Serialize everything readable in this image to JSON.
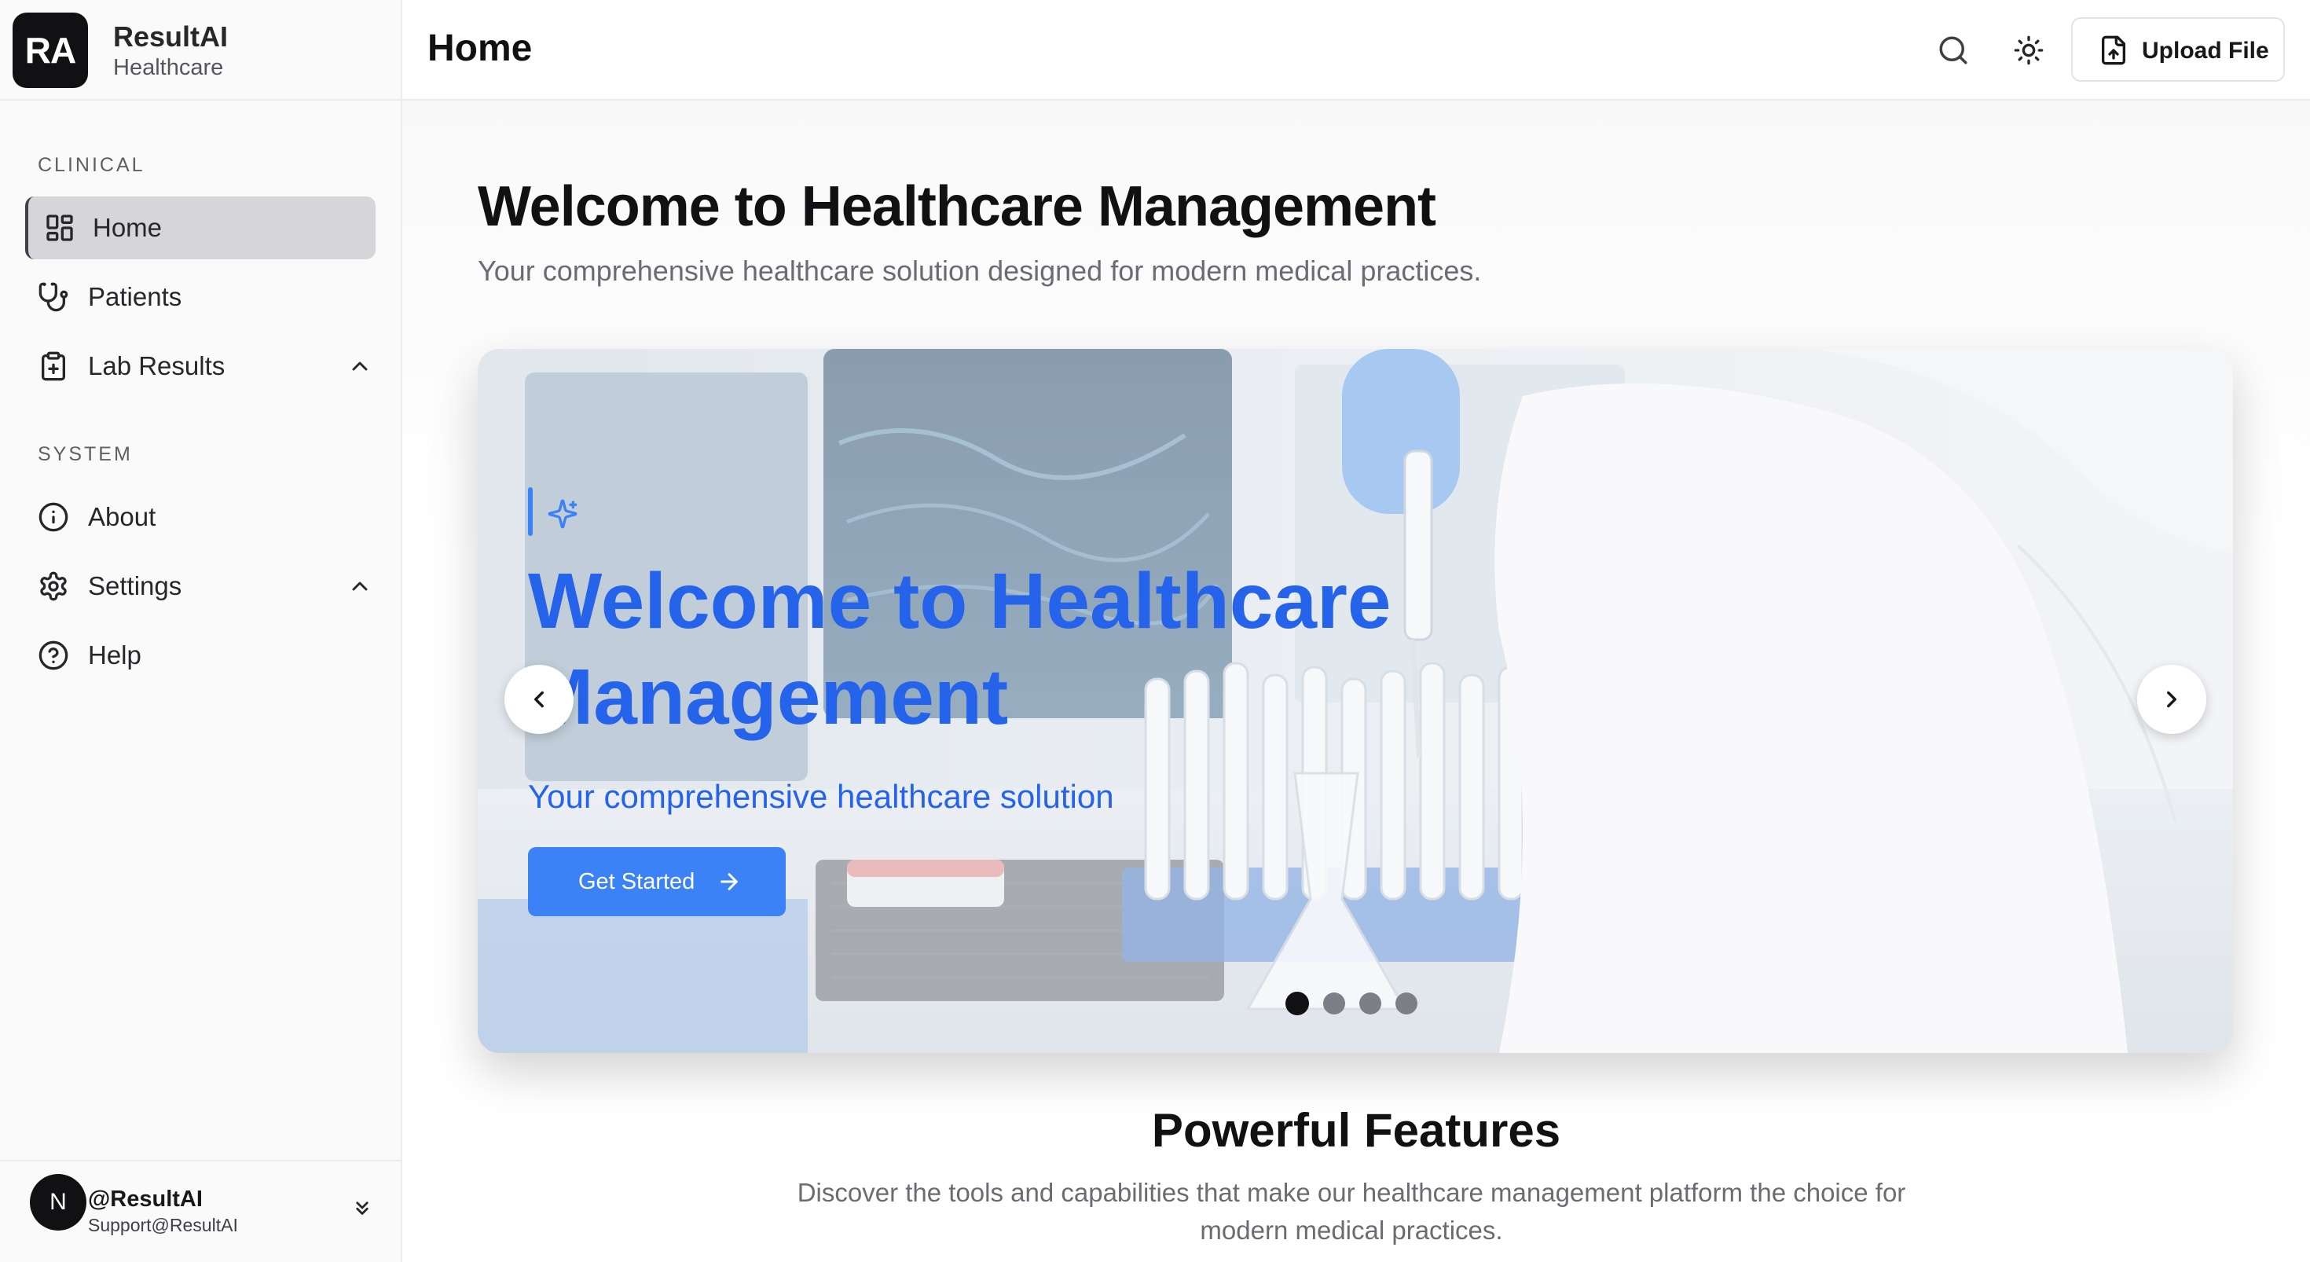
{
  "brand": {
    "logo_text": "RA",
    "name": "ResultAI",
    "subtitle": "Healthcare"
  },
  "sidebar": {
    "clinical_label": "CLINICAL",
    "clinical_items": [
      {
        "label": "Home",
        "icon": "dashboard-icon",
        "active": true
      },
      {
        "label": "Patients",
        "icon": "stethoscope-icon"
      },
      {
        "label": "Lab Results",
        "icon": "clipboard-plus-icon",
        "expandable": true
      }
    ],
    "system_label": "SYSTEM",
    "system_items": [
      {
        "label": "About",
        "icon": "info-icon"
      },
      {
        "label": "Settings",
        "icon": "gear-icon",
        "expandable": true
      },
      {
        "label": "Help",
        "icon": "help-circle-icon"
      }
    ],
    "user": {
      "avatar_text": "N",
      "name": "@ResultAI",
      "email": "Support@ResultAI"
    }
  },
  "header": {
    "title": "Home",
    "upload_label": "Upload File"
  },
  "main": {
    "welcome_title": "Welcome to Healthcare Management",
    "welcome_subtitle": "Your comprehensive healthcare solution designed for modern medical practices.",
    "hero": {
      "title": "Welcome to Healthcare Management",
      "subtitle": "Your comprehensive healthcare solution",
      "cta_label": "Get Started",
      "slide_count": 4,
      "active_slide": 1
    },
    "features_title": "Powerful Features",
    "features_text": "Discover the tools and capabilities that make our healthcare management platform the choice for modern medical practices."
  },
  "colors": {
    "accent": "#3b82f6",
    "accent_text": "#2563eb",
    "sidebar_active": "#d6d6da"
  }
}
